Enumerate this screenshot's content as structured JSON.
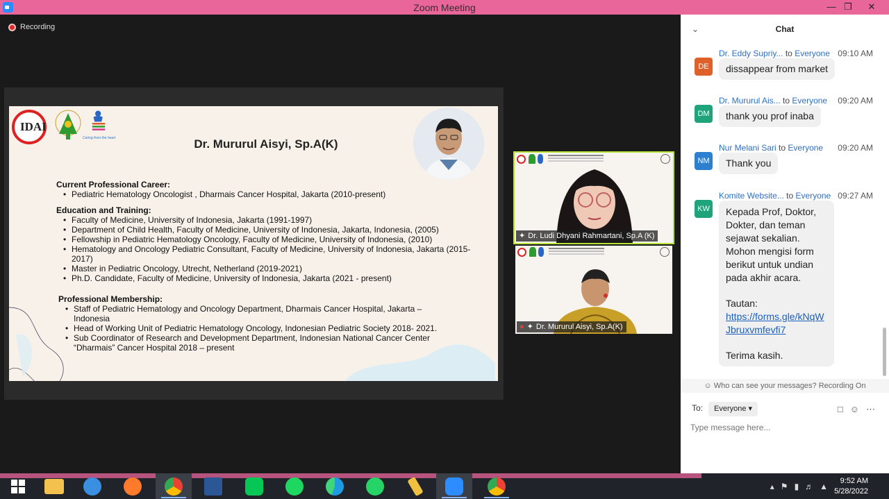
{
  "window": {
    "title": "Zoom Meeting",
    "min_icon": "minimize-icon",
    "max_icon": "maximize-icon",
    "close_icon": "close-icon"
  },
  "recording": {
    "label": "Recording"
  },
  "slide": {
    "name": "Dr. Mururul Aisyi, Sp.A(K)",
    "logo_text": "IDAI",
    "tagline": "Caring from the heart",
    "sections": [
      {
        "heading": "Current Professional Career:",
        "items": [
          "Pediatric Hematology Oncologist , Dharmais Cancer Hospital, Jakarta (2010-present)"
        ]
      },
      {
        "heading": "Education and Training:",
        "items": [
          "Faculty of Medicine, University of Indonesia, Jakarta (1991-1997)",
          "Department of Child Health, Faculty of Medicine, University of Indonesia, Jakarta, Indonesia, (2005)",
          "Fellowship in Pediatric Hematology Oncology, Faculty of Medicine, University of Indonesia, (2010)",
          "Hematology and Oncology Pediatric Consultant, Faculty of Medicine, University of Indonesia, Jakarta (2015- 2017)",
          "Master in Pediatric Oncology, Utrecht, Netherland (2019-2021)",
          "Ph.D. Candidate, Faculty of Medicine, University of Indonesia, Jakarta (2021 - present)"
        ]
      },
      {
        "heading": "Professional Membership:",
        "items": [
          "Staff of Pediatric Hematology and Oncology Department, Dharmais Cancer Hospital, Jakarta – Indonesia",
          "Head of Working Unit of Pediatric Hematology Oncology, Indonesian Pediatric Society 2018- 2021.",
          "Sub Coordinator of Research and Development Department, Indonesian National Cancer Center “Dharmais” Cancer Hospital 2018 – present"
        ]
      }
    ]
  },
  "videos": [
    {
      "name": "Dr. Ludi Dhyani Rahmartani, Sp.A (K)"
    },
    {
      "name": "Dr. Mururul Aisyi, Sp.A(K)"
    }
  ],
  "chat": {
    "title": "Chat",
    "messages": [
      {
        "sender": "Dr. Eddy Supriy...",
        "to": "to",
        "recipient": "Everyone",
        "time": "09:10 AM",
        "initials": "DE",
        "color": "#e0602a",
        "text": "dissappear from market"
      },
      {
        "sender": "Dr. Mururul Ais...",
        "to": "to",
        "recipient": "Everyone",
        "time": "09:20 AM",
        "initials": "DM",
        "color": "#1fa37a",
        "text": "thank you prof inaba"
      },
      {
        "sender": "Nur Melani Sari",
        "to": "to",
        "recipient": "Everyone",
        "time": "09:20 AM",
        "initials": "NM",
        "color": "#2d7fd0",
        "text": "Thank you"
      },
      {
        "sender": "Komite Website...",
        "to": "to",
        "recipient": "Everyone",
        "time": "09:27 AM",
        "initials": "KW",
        "color": "#1fa37a",
        "lines": [
          "Kepada Prof, Doktor,",
          "Dokter, dan teman",
          "sejawat sekalian.",
          "Mohon mengisi form",
          "berikut untuk undian",
          "pada akhir acara."
        ],
        "link_label": "Tautan:",
        "link_lines": [
          "https://forms.gle/kNqW",
          "Jbruxvmfevfi7"
        ],
        "closing": "Terima kasih."
      }
    ],
    "who_can_see": "Who can see your messages? Recording On",
    "to_label": "To:",
    "to_value": "Everyone",
    "input_placeholder": "Type message here..."
  },
  "taskbar": {
    "time": "9:52 AM",
    "date": "5/28/2022",
    "apps": [
      {
        "name": "start",
        "color": "#ffffff"
      },
      {
        "name": "file-explorer",
        "color": "#f2c14e"
      },
      {
        "name": "internet-explorer",
        "color": "#3a8fe0"
      },
      {
        "name": "firefox",
        "color": "#ff7a2a"
      },
      {
        "name": "chrome",
        "color": "#34a853"
      },
      {
        "name": "word",
        "color": "#2b5797"
      },
      {
        "name": "line",
        "color": "#06c755"
      },
      {
        "name": "spotify",
        "color": "#1ed760"
      },
      {
        "name": "edge",
        "color": "#1f9be0"
      },
      {
        "name": "whatsapp",
        "color": "#25d366"
      },
      {
        "name": "sticky-tool",
        "color": "#f0c040"
      },
      {
        "name": "zoom",
        "color": "#2d8cff"
      },
      {
        "name": "chrome-profile",
        "color": "#ea4335"
      }
    ]
  }
}
